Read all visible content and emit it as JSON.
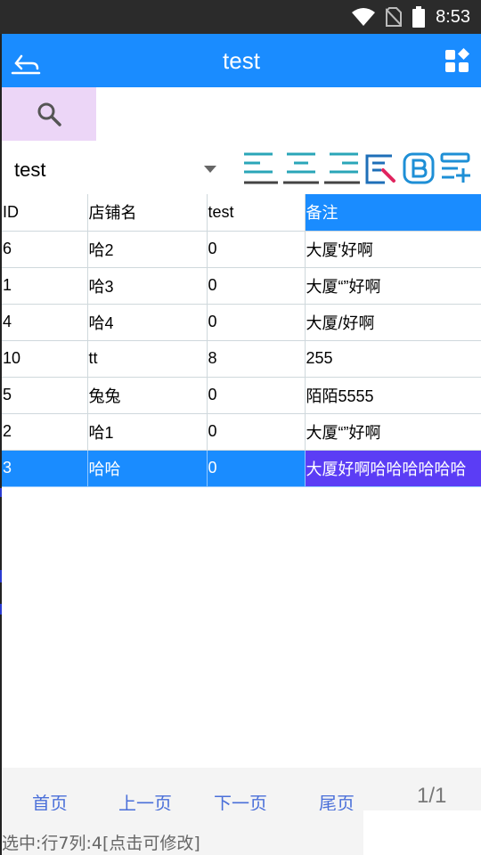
{
  "status_bar": {
    "time": "8:53"
  },
  "app_bar": {
    "title": "test"
  },
  "table_selector": {
    "value": "test"
  },
  "grid": {
    "columns": [
      "ID",
      "店铺名",
      "test",
      "备注"
    ],
    "rows": [
      [
        "6",
        "哈2",
        "0",
        "大厦'好啊"
      ],
      [
        "1",
        "哈3",
        "0",
        "大厦“”好啊"
      ],
      [
        "4",
        "哈4",
        "0",
        "大厦/好啊"
      ],
      [
        "10",
        "tt",
        "8",
        "255"
      ],
      [
        "5",
        "兔兔",
        "0",
        "陌陌5555"
      ],
      [
        "2",
        "哈1",
        "0",
        "大厦“”好啊"
      ],
      [
        "3",
        "哈哈",
        "0",
        "大厦好啊哈哈哈哈哈哈"
      ]
    ]
  },
  "pager": {
    "first": "首页",
    "prev": "上一页",
    "next": "下一页",
    "last": "尾页",
    "page_info": "1/1"
  },
  "selection_status": "选中:行7列:4[点击可修改]",
  "colors": {
    "accent": "#1a8cff",
    "selected_cell": "#5b3df5",
    "search_bg": "#ecd6f7",
    "link": "#4a6fd9"
  }
}
